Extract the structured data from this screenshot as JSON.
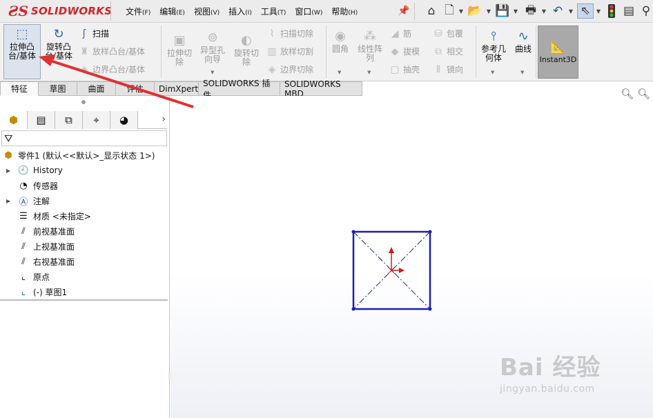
{
  "logo": {
    "ds": "ƧS",
    "wordmark": "SOLIDWORKS"
  },
  "menu": [
    {
      "label": "文件",
      "key": "(F)"
    },
    {
      "label": "编辑",
      "key": "(E)"
    },
    {
      "label": "视图",
      "key": "(V)"
    },
    {
      "label": "插入",
      "key": "(I)"
    },
    {
      "label": "工具",
      "key": "(T)"
    },
    {
      "label": "窗口",
      "key": "(W)"
    },
    {
      "label": "帮助",
      "key": "(H)"
    }
  ],
  "quick_access": [
    "home-icon",
    "new-document-icon",
    "open-icon",
    "save-icon",
    "print-icon",
    "undo-icon",
    "select-icon",
    "rebuild-icon",
    "options-icon",
    "search-icon"
  ],
  "features": {
    "extrude_boss": "拉伸凸台/基体",
    "revolve_boss": "旋转凸台/基体",
    "sweep": "扫描",
    "loft_boss": "放样凸台/基体",
    "boundary_boss": "边界凸台/基体",
    "extrude_cut": "拉伸切除",
    "hole_wizard": "异型孔向导",
    "revolve_cut": "旋转切除",
    "swept_cut": "扫描切除",
    "lofted_cut": "放样切割",
    "boundary_cut": "边界切除",
    "fillet": "圆角",
    "linear_pattern": "线性阵列",
    "rib": "筋",
    "draft": "拔模",
    "shell": "抽壳",
    "wrap": "包覆",
    "intersect": "相交",
    "mirror": "镜向",
    "reference_geometry": "参考几何体",
    "curves": "曲线",
    "instant3d": "Instant3D"
  },
  "tabs": [
    "特征",
    "草图",
    "曲面",
    "评估",
    "DimXpert",
    "SOLIDWORKS 插件",
    "SOLIDWORKS MBD"
  ],
  "tree": {
    "root": "零件1  (默认<<默认>_显示状态 1>)",
    "items": [
      "History",
      "传感器",
      "注解",
      "材质 <未指定>",
      "前视基准面",
      "上视基准面",
      "右视基准面",
      "原点",
      "(-) 草图1"
    ]
  },
  "watermark": {
    "line1": "Bai 经验",
    "line2": "jingyan.baidu.com"
  },
  "colors": {
    "brand_red": "#d6232b",
    "sketch_blue": "#1d1db5",
    "origin_red": "#d11a1a",
    "arrow_red": "#e03030"
  }
}
